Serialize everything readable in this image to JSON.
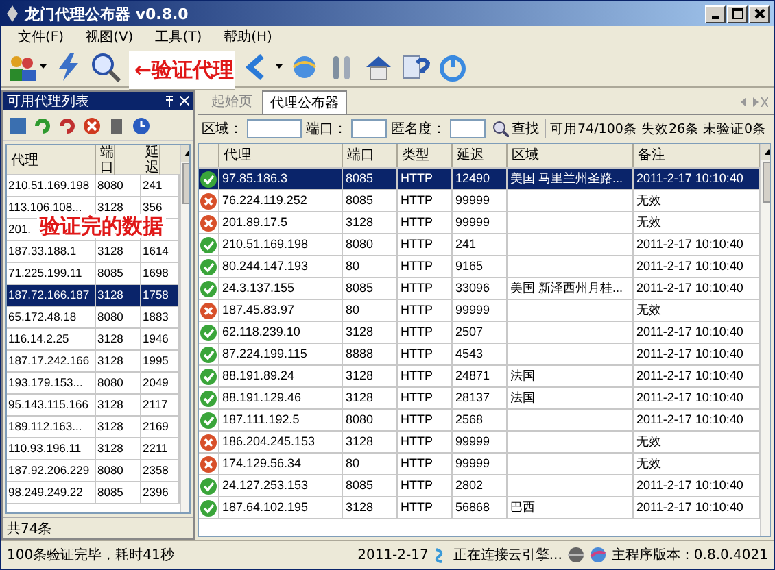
{
  "window": {
    "title": "龙门代理公布器 v0.8.0"
  },
  "menu": [
    "文件(F)",
    "视图(V)",
    "工具(T)",
    "帮助(H)"
  ],
  "toolbar": [
    {
      "kind": "people",
      "caret": true
    },
    {
      "kind": "bolt",
      "caret": false
    },
    {
      "kind": "search",
      "caret": false
    },
    {
      "kind": "arrow",
      "caret": true
    },
    {
      "kind": "globe",
      "caret": false
    },
    {
      "kind": "tools",
      "caret": false
    },
    {
      "kind": "house",
      "caret": false
    },
    {
      "kind": "help",
      "caret": false
    },
    {
      "kind": "power",
      "caret": false
    }
  ],
  "annotations": [
    {
      "text": "←验证代理",
      "kind": "toolbar"
    },
    {
      "text": "验证完的数据",
      "kind": "list"
    }
  ],
  "left_panel": {
    "title": "可用代理列表",
    "tools": [
      {
        "kind": "save"
      },
      {
        "kind": "refresh"
      },
      {
        "kind": "refresh2"
      },
      {
        "kind": "delete"
      },
      {
        "kind": "trash"
      },
      {
        "kind": "clock"
      }
    ],
    "columns": [
      "代理",
      "端口",
      "延迟"
    ],
    "rows": [
      {
        "proxy": "210.51.169.198",
        "port": "8080",
        "delay": "241",
        "selected": false
      },
      {
        "proxy": "113.106.108...",
        "port": "3128",
        "delay": "356",
        "selected": false
      },
      {
        "proxy": "201.",
        "selected": false
      },
      {
        "proxy": "187.33.188.1",
        "port": "3128",
        "delay": "1614",
        "selected": false
      },
      {
        "proxy": "71.225.199.11",
        "port": "8085",
        "delay": "1698",
        "selected": false
      },
      {
        "proxy": "187.72.166.187",
        "port": "3128",
        "delay": "1758",
        "selected": true
      },
      {
        "proxy": "65.172.48.18",
        "port": "8080",
        "delay": "1883",
        "selected": false
      },
      {
        "proxy": "116.14.2.25",
        "port": "3128",
        "delay": "1946",
        "selected": false
      },
      {
        "proxy": "187.17.242.166",
        "port": "3128",
        "delay": "1995",
        "selected": false
      },
      {
        "proxy": "193.179.153...",
        "port": "8080",
        "delay": "2049",
        "selected": false
      },
      {
        "proxy": "95.143.115.166",
        "port": "3128",
        "delay": "2117",
        "selected": false
      },
      {
        "proxy": "189.112.163...",
        "port": "3128",
        "delay": "2169",
        "selected": false
      },
      {
        "proxy": "110.93.196.11",
        "port": "3128",
        "delay": "2211",
        "selected": false
      },
      {
        "proxy": "187.92.206.229",
        "port": "8080",
        "delay": "2358",
        "selected": false
      },
      {
        "proxy": "98.249.249.22",
        "port": "8085",
        "delay": "2396",
        "selected": false
      }
    ],
    "count": "共74条"
  },
  "tabs": [
    {
      "label": "起始页",
      "selected": false
    },
    {
      "label": "代理公布器",
      "selected": true
    }
  ],
  "filter": {
    "area_label": "区域：",
    "port_label": "端口：",
    "anon_label": "匿名度：",
    "search_button": "查找",
    "summary": "可用74/100条 失效26条 未验证0条"
  },
  "table": {
    "columns": [
      "代理",
      "端口",
      "类型",
      "延迟",
      "区域",
      "备注"
    ],
    "rows": [
      {
        "ok": true,
        "selected": true,
        "cells": [
          "97.85.186.3",
          "8085",
          "HTTP",
          "12490",
          "美国 马里兰州圣路...",
          "2011-2-17 10:10:40"
        ]
      },
      {
        "ok": false,
        "selected": false,
        "cells": [
          "76.224.119.252",
          "8085",
          "HTTP",
          "99999",
          "",
          "无效"
        ]
      },
      {
        "ok": false,
        "selected": false,
        "cells": [
          "201.89.17.5",
          "3128",
          "HTTP",
          "99999",
          "",
          "无效"
        ]
      },
      {
        "ok": true,
        "selected": false,
        "cells": [
          "210.51.169.198",
          "8080",
          "HTTP",
          "241",
          "",
          "2011-2-17 10:10:40"
        ]
      },
      {
        "ok": true,
        "selected": false,
        "cells": [
          "80.244.147.193",
          "80",
          "HTTP",
          "9165",
          "",
          "2011-2-17 10:10:40"
        ]
      },
      {
        "ok": true,
        "selected": false,
        "cells": [
          "24.3.137.155",
          "8085",
          "HTTP",
          "33096",
          "美国 新泽西州月桂...",
          "2011-2-17 10:10:40"
        ]
      },
      {
        "ok": false,
        "selected": false,
        "cells": [
          "187.45.83.97",
          "80",
          "HTTP",
          "99999",
          "",
          "无效"
        ]
      },
      {
        "ok": true,
        "selected": false,
        "cells": [
          "62.118.239.10",
          "3128",
          "HTTP",
          "2507",
          "",
          "2011-2-17 10:10:40"
        ]
      },
      {
        "ok": true,
        "selected": false,
        "cells": [
          "87.224.199.115",
          "8888",
          "HTTP",
          "4543",
          "",
          "2011-2-17 10:10:40"
        ]
      },
      {
        "ok": true,
        "selected": false,
        "cells": [
          "88.191.89.24",
          "3128",
          "HTTP",
          "24871",
          "法国",
          "2011-2-17 10:10:40"
        ]
      },
      {
        "ok": true,
        "selected": false,
        "cells": [
          "88.191.129.46",
          "3128",
          "HTTP",
          "28137",
          "法国",
          "2011-2-17 10:10:40"
        ]
      },
      {
        "ok": true,
        "selected": false,
        "cells": [
          "187.111.192.5",
          "8080",
          "HTTP",
          "2568",
          "",
          "2011-2-17 10:10:40"
        ]
      },
      {
        "ok": false,
        "selected": false,
        "cells": [
          "186.204.245.153",
          "3128",
          "HTTP",
          "99999",
          "",
          "无效"
        ]
      },
      {
        "ok": false,
        "selected": false,
        "cells": [
          "174.129.56.34",
          "80",
          "HTTP",
          "99999",
          "",
          "无效"
        ]
      },
      {
        "ok": true,
        "selected": false,
        "cells": [
          "24.127.253.153",
          "8085",
          "HTTP",
          "2802",
          "",
          "2011-2-17 10:10:40"
        ]
      },
      {
        "ok": true,
        "selected": false,
        "cells": [
          "187.64.102.195",
          "3128",
          "HTTP",
          "56868",
          "巴西",
          "2011-2-17 10:10:40"
        ]
      }
    ]
  },
  "status_bar": {
    "message": "100条验证完毕，耗时41秒",
    "date": "2011-2-17",
    "connection": "正在连接云引擎...",
    "version": "主程序版本：0.8.0.4021"
  }
}
